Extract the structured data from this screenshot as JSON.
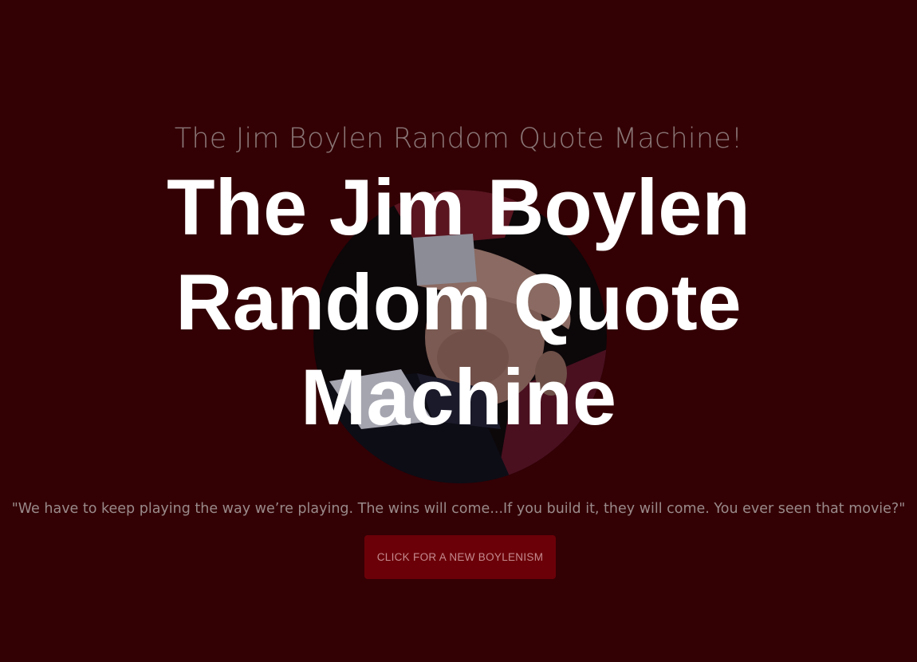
{
  "header": {
    "small_title": "The Jim Boylen Random Quote Machine!",
    "big_title_lines": [
      "The Jim Boylen",
      "Random Quote",
      "Machine"
    ]
  },
  "photo": {
    "subject": "Jim Boylen"
  },
  "quote": {
    "text": "\"We have to keep playing the way we’re playing. The wins will come...If you build it, they will come. You ever seen that movie?\""
  },
  "button": {
    "label": "CLICK FOR A NEW BOYLENISM"
  },
  "colors": {
    "background": "#330004",
    "button": "#6b0008",
    "title_text": "#ffffff"
  }
}
